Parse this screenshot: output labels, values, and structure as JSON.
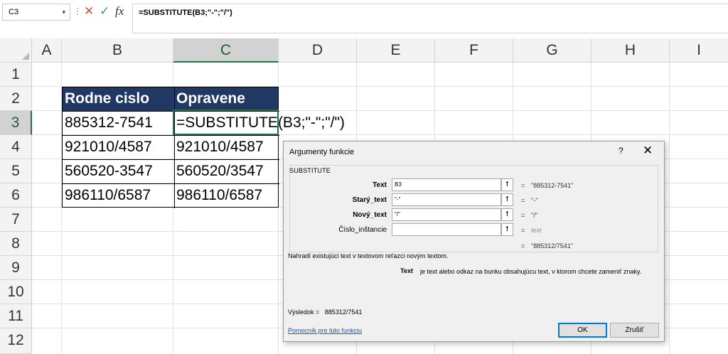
{
  "formula_bar": {
    "name_box": "C3",
    "name_box_dropdown": "▾",
    "separator": "⋮",
    "cancel_symbol": "✕",
    "enter_symbol": "✓",
    "fx_label": "fx",
    "formula": "=SUBSTITUTE(B3;\"-\";\"/\")"
  },
  "columns": [
    "A",
    "B",
    "C",
    "D",
    "E",
    "F",
    "G",
    "H",
    "I"
  ],
  "rows": [
    "1",
    "2",
    "3",
    "4",
    "5",
    "6",
    "7",
    "8",
    "9",
    "10",
    "11",
    "12"
  ],
  "selected_cell": "C3",
  "table": {
    "headers": [
      "Rodne cislo",
      "Opravene"
    ],
    "rows": [
      [
        "885312-7541",
        "=SUBSTITUTE(B3;\"-\";\"/\")"
      ],
      [
        "921010/4587",
        "921010/4587"
      ],
      [
        "560520-3547",
        "560520/3547"
      ],
      [
        "986110/6587",
        "986110/6587"
      ]
    ]
  },
  "colors": {
    "header_fill": "#203864",
    "header_text": "#FFFFFF",
    "selection": "#217346"
  },
  "dialog": {
    "title": "Argumenty funkcie",
    "help": "?",
    "close": "✕",
    "function_name": "SUBSTITUTE",
    "arguments": [
      {
        "label": "Text",
        "bold": true,
        "value": "B3",
        "result": "\"885312-7541\""
      },
      {
        "label": "Starý_text",
        "bold": true,
        "value": "\"-\"",
        "result": "\"-\""
      },
      {
        "label": "Nový_text",
        "bold": true,
        "value": "\"/\"",
        "result": "\"/\""
      },
      {
        "label": "Číslo_inštancie",
        "bold": false,
        "value": "",
        "result": "text"
      }
    ],
    "ref_icon": "⭡",
    "equals": "=",
    "formula_result": "\"885312/7541\"",
    "description": "Nahradí existujúci text v textovom reťazci novým textom.",
    "arg_help_name": "Text",
    "arg_help_text": "je text alebo odkaz na bunku obsahujúcu text, v ktorom chcete zameniť znaky.",
    "result_label": "Výsledok =",
    "result_value": "885312/7541",
    "help_link": "Pomocník pre túto funkciu",
    "ok": "OK",
    "cancel": "Zrušiť"
  }
}
